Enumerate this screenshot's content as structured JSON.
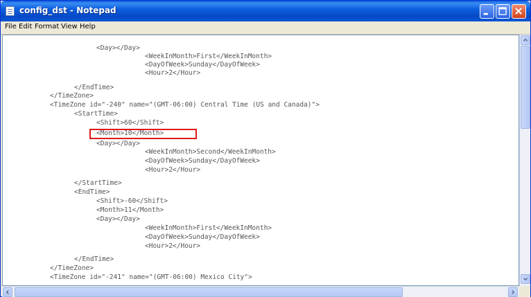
{
  "window": {
    "title": "config_dst - Notepad"
  },
  "menu": {
    "items": [
      "File",
      "Edit",
      "Format",
      "View",
      "Help"
    ]
  },
  "editor": {
    "lines": [
      "<Day></Day>",
      "<WeekInMonth>First</WeekInMonth>",
      "<DayOfWeek>Sunday</DayOfWeek>",
      "<Hour>2</Hour>",
      "</EndTime>",
      "</TimeZone>",
      "<TimeZone id=\"-240\" name=\"(GMT-06:00) Central Time (US and Canada)\">",
      "<StartTime>",
      "<Shift>60</Shift>",
      "<Month>10</Month>",
      "<Day></Day>",
      "<WeekInMonth>Second</WeekInMonth>",
      "<DayOfWeek>Sunday</DayOfWeek>",
      "<Hour>2</Hour>",
      "</StartTime>",
      "<EndTime>",
      "<Shift>-60</Shift>",
      "<Month>11</Month>",
      "<Day></Day>",
      "<WeekInMonth>First</WeekInMonth>",
      "<DayOfWeek>Sunday</DayOfWeek>",
      "<Hour>2</Hour>",
      "</EndTime>",
      "</TimeZone>",
      "<TimeZone id=\"-241\" name=\"(GMT-06:00) Mexico City\">"
    ],
    "highlighted_line_index": 9,
    "highlight_color": "#e01818"
  },
  "icons": {
    "app": "notepad-icon",
    "minimize": "minimize-icon",
    "maximize": "maximize-icon",
    "close": "close-icon"
  },
  "colors": {
    "titlebar": "#0a5bd8",
    "close_button": "#d2431c",
    "text": "#555555"
  }
}
